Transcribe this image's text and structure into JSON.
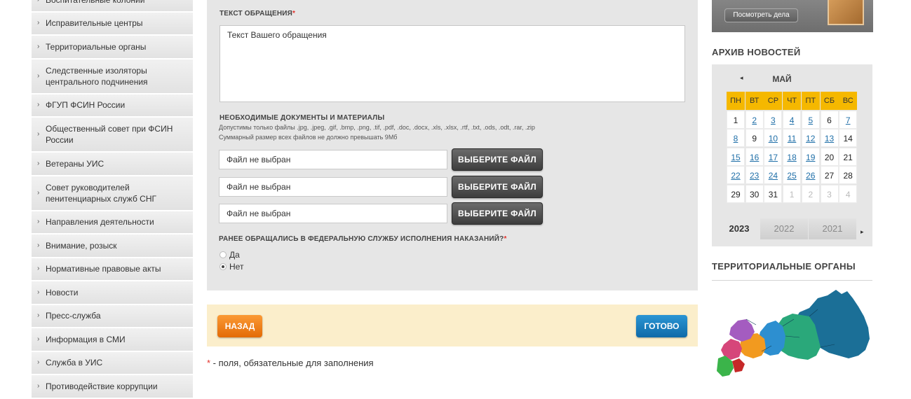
{
  "sidebar": {
    "items": [
      {
        "label": "Воспитательные колонии",
        "lines": 1
      },
      {
        "label": "Исправительные центры",
        "lines": 1
      },
      {
        "label": "Территориальные органы",
        "lines": 1
      },
      {
        "label": "Следственные изоляторы центрального подчинения",
        "lines": 2
      },
      {
        "label": "ФГУП ФСИН России",
        "lines": 1
      },
      {
        "label": "Общественный совет при ФСИН России",
        "lines": 2
      },
      {
        "label": "Ветераны УИС",
        "lines": 1
      },
      {
        "label": "Совет руководителей пенитенциарных служб СНГ",
        "lines": 2
      },
      {
        "label": "Направления деятельности",
        "lines": 1
      },
      {
        "label": "Внимание, розыск",
        "lines": 1
      },
      {
        "label": "Нормативные правовые акты",
        "lines": 1
      },
      {
        "label": "Новости",
        "lines": 1
      },
      {
        "label": "Пресс-служба",
        "lines": 1
      },
      {
        "label": "Информация в СМИ",
        "lines": 1
      },
      {
        "label": "Служба в УИС",
        "lines": 1
      },
      {
        "label": "Противодействие коррупции",
        "lines": 1
      }
    ],
    "chevron": "›"
  },
  "form": {
    "text_label": "ТЕКСТ ОБРАЩЕНИЯ",
    "required_mark": "*",
    "text_value": "Текст Вашего обращения",
    "docs_label": "НЕОБХОДИМЫЕ ДОКУМЕНТЫ И МАТЕРИАЛЫ",
    "docs_hint_1": "Допустимы только файлы .jpg, .jpeg, .gif, .bmp, .png, .tif, .pdf, .doc, .docx, .xls, .xlsx, .rtf, .txt, .ods, .odt, .rar, .zip",
    "docs_hint_2": "Суммарный размер всех файлов не должно превышать 9Мб",
    "files": [
      {
        "value": "Файл не выбран",
        "button": "ВЫБЕРИТЕ ФАЙЛ"
      },
      {
        "value": "Файл не выбран",
        "button": "ВЫБЕРИТЕ ФАЙЛ"
      },
      {
        "value": "Файл не выбран",
        "button": "ВЫБЕРИТЕ ФАЙЛ"
      }
    ],
    "prev_question": "РАНЕЕ ОБРАЩАЛИСЬ В ФЕДЕРАЛЬНУЮ СЛУЖБУ ИСПОЛНЕНИЯ НАКАЗАНИЙ?",
    "radios": [
      {
        "label": "Да",
        "checked": false
      },
      {
        "label": "Нет",
        "checked": true
      }
    ]
  },
  "actions": {
    "back": "НАЗАД",
    "done": "ГОТОВО"
  },
  "required_note": {
    "mark": "*",
    "text": " - поля, обязательные для заполнения"
  },
  "banner": {
    "button": "Посмотреть дела"
  },
  "news_archive": {
    "title": "АРХИВ НОВОСТЕЙ",
    "prev": "◂",
    "month": "МАЙ",
    "weekdays": [
      "ПН",
      "ВТ",
      "СР",
      "ЧТ",
      "ПТ",
      "СБ",
      "ВС"
    ],
    "weeks": [
      [
        {
          "d": "1",
          "t": "plain"
        },
        {
          "d": "2",
          "t": "link"
        },
        {
          "d": "3",
          "t": "link"
        },
        {
          "d": "4",
          "t": "link"
        },
        {
          "d": "5",
          "t": "link"
        },
        {
          "d": "6",
          "t": "plain"
        },
        {
          "d": "7",
          "t": "link"
        }
      ],
      [
        {
          "d": "8",
          "t": "link"
        },
        {
          "d": "9",
          "t": "plain"
        },
        {
          "d": "10",
          "t": "link"
        },
        {
          "d": "11",
          "t": "link"
        },
        {
          "d": "12",
          "t": "link"
        },
        {
          "d": "13",
          "t": "link"
        },
        {
          "d": "14",
          "t": "plain"
        }
      ],
      [
        {
          "d": "15",
          "t": "link"
        },
        {
          "d": "16",
          "t": "link"
        },
        {
          "d": "17",
          "t": "link"
        },
        {
          "d": "18",
          "t": "link"
        },
        {
          "d": "19",
          "t": "link"
        },
        {
          "d": "20",
          "t": "plain"
        },
        {
          "d": "21",
          "t": "plain"
        }
      ],
      [
        {
          "d": "22",
          "t": "link"
        },
        {
          "d": "23",
          "t": "link"
        },
        {
          "d": "24",
          "t": "link"
        },
        {
          "d": "25",
          "t": "link"
        },
        {
          "d": "26",
          "t": "link"
        },
        {
          "d": "27",
          "t": "plain"
        },
        {
          "d": "28",
          "t": "plain"
        }
      ],
      [
        {
          "d": "29",
          "t": "plain"
        },
        {
          "d": "30",
          "t": "plain"
        },
        {
          "d": "31",
          "t": "plain"
        },
        {
          "d": "1",
          "t": "other"
        },
        {
          "d": "2",
          "t": "other"
        },
        {
          "d": "3",
          "t": "other"
        },
        {
          "d": "4",
          "t": "other"
        }
      ]
    ],
    "years": [
      "2023",
      "2022",
      "2021"
    ],
    "active_year": "2023",
    "next": "▸"
  },
  "territorial": {
    "title": "ТЕРРИТОРИАЛЬНЫЕ ОРГАНЫ"
  },
  "colors": {
    "accent_orange": "#f07b12",
    "accent_blue": "#1a7fc0",
    "calendar_head": "#f5b800",
    "required": "#e3322b"
  }
}
